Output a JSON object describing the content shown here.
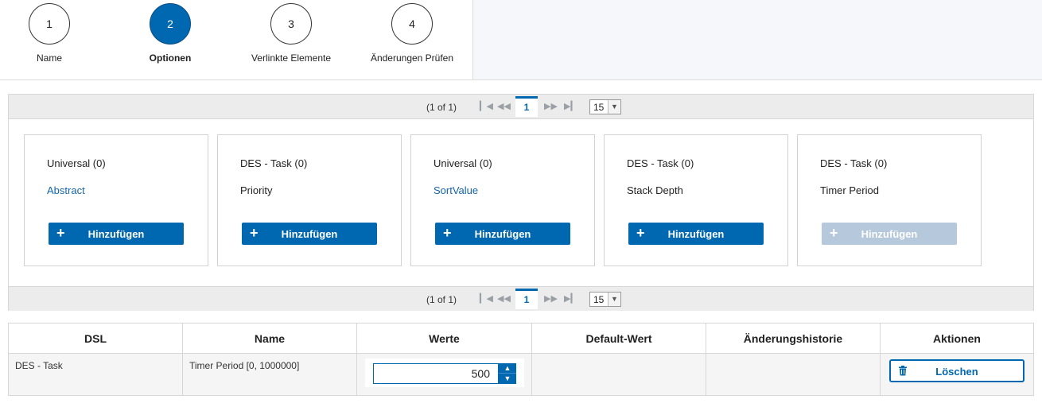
{
  "wizard": {
    "steps": [
      {
        "number": "1",
        "label": "Name",
        "active": false
      },
      {
        "number": "2",
        "label": "Optionen",
        "active": true
      },
      {
        "number": "3",
        "label": "Verlinkte Elemente",
        "active": false
      },
      {
        "number": "4",
        "label": "Änderungen Prüfen",
        "active": false
      }
    ]
  },
  "paginator": {
    "report": "(1 of 1)",
    "current_page": "1",
    "rows_per_page": "15",
    "icons": [
      "first-page-icon",
      "prev-page-icon",
      "next-page-icon",
      "last-page-icon"
    ]
  },
  "cards": [
    {
      "category": "Universal (0)",
      "name": "Abstract",
      "name_is_link": true,
      "button": "Hinzufügen",
      "disabled": false
    },
    {
      "category": "DES - Task (0)",
      "name": "Priority",
      "name_is_link": false,
      "button": "Hinzufügen",
      "disabled": false
    },
    {
      "category": "Universal (0)",
      "name": "SortValue",
      "name_is_link": true,
      "button": "Hinzufügen",
      "disabled": false
    },
    {
      "category": "DES - Task (0)",
      "name": "Stack Depth",
      "name_is_link": false,
      "button": "Hinzufügen",
      "disabled": false
    },
    {
      "category": "DES - Task (0)",
      "name": "Timer Period",
      "name_is_link": false,
      "button": "Hinzufügen",
      "disabled": true
    }
  ],
  "table": {
    "headers": [
      "DSL",
      "Name",
      "Werte",
      "Default-Wert",
      "Änderungshistorie",
      "Aktionen"
    ],
    "rows": [
      {
        "dsl": "DES - Task",
        "name": "Timer Period [0, 1000000]",
        "value": "500",
        "default": "",
        "history": "",
        "action": "Löschen"
      }
    ]
  },
  "colors": {
    "accent": "#0067b1",
    "disabled": "#b6c8dc",
    "link": "#1565a8"
  }
}
